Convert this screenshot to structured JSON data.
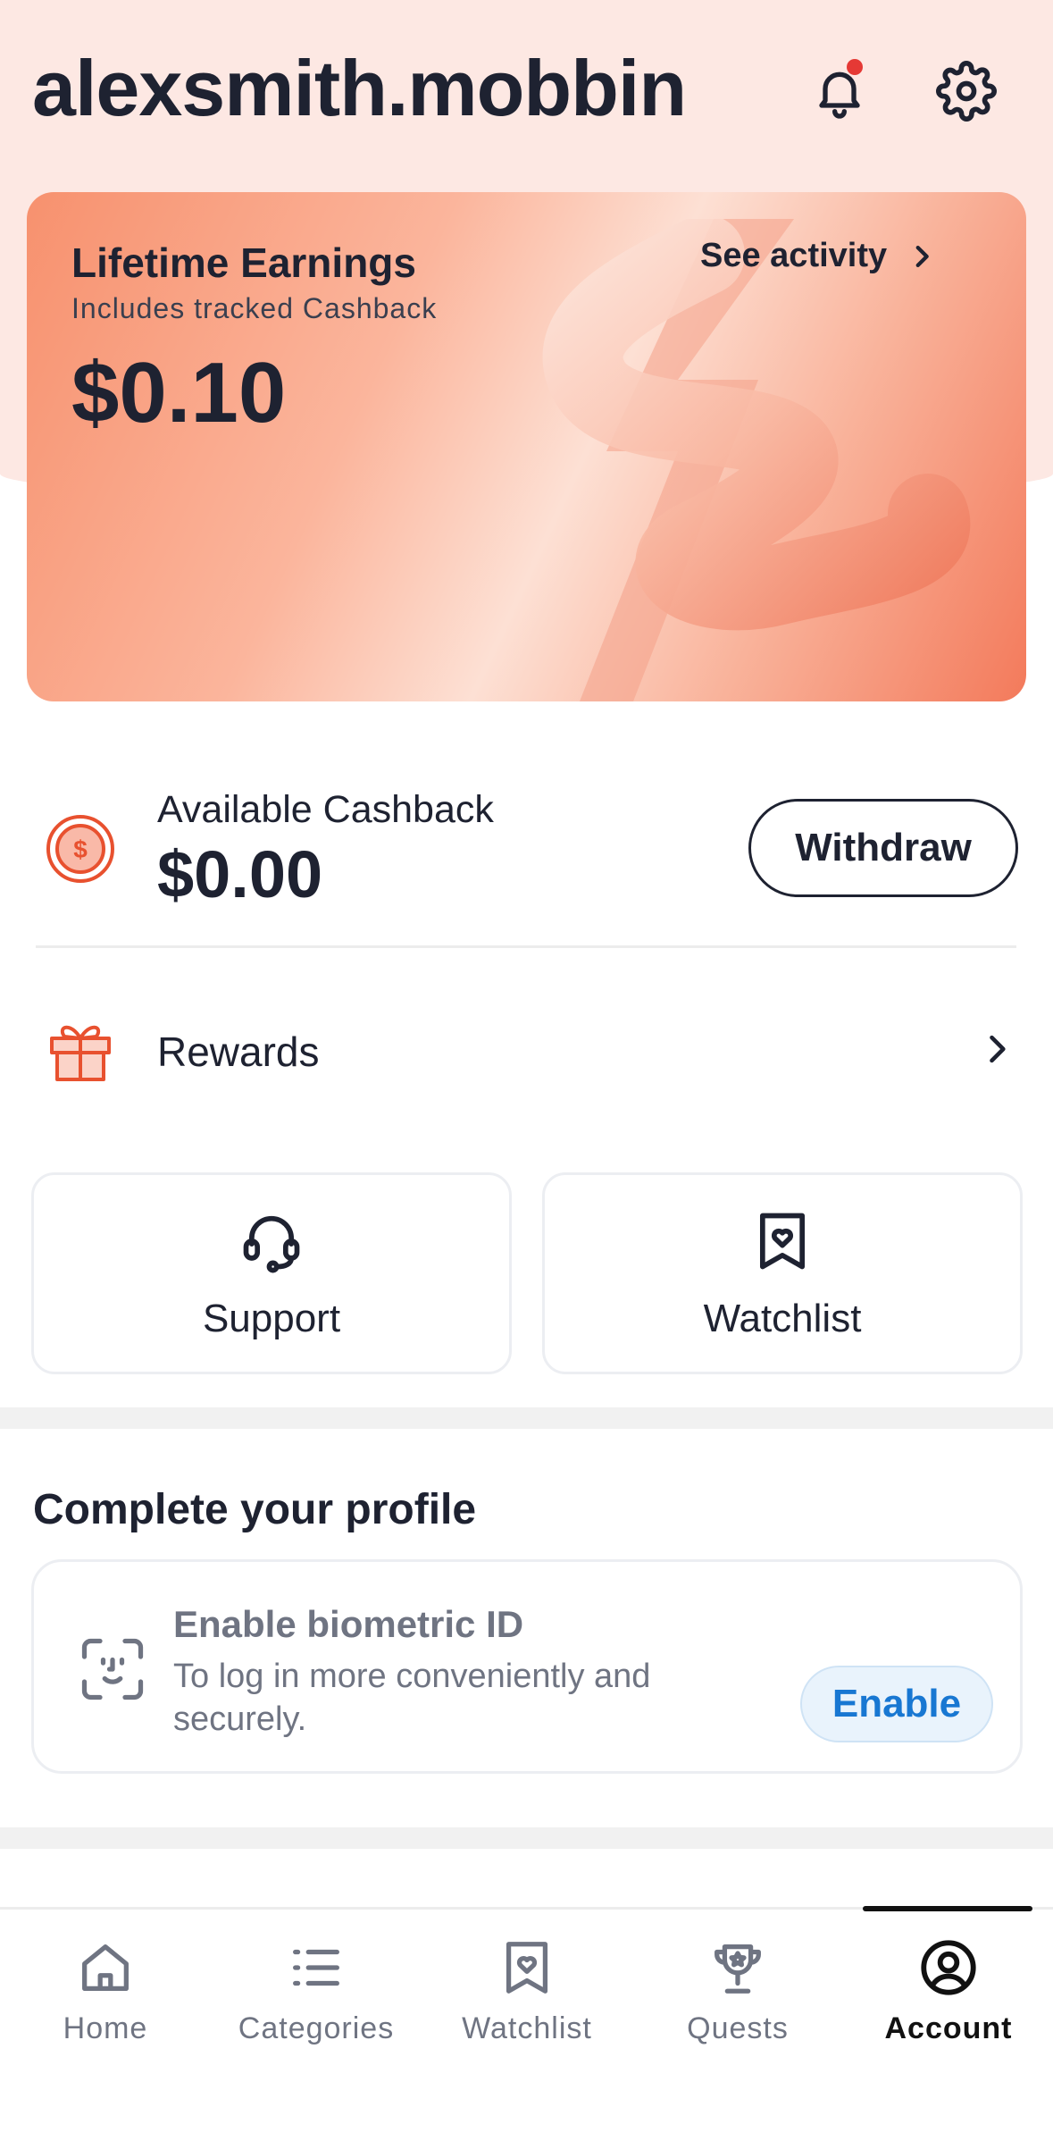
{
  "header": {
    "username": "alexsmith.mobbin",
    "has_notification": true
  },
  "earnings_card": {
    "title": "Lifetime Earnings",
    "subtitle": "Includes tracked Cashback",
    "amount": "$0.10",
    "link_label": "See activity"
  },
  "cashback": {
    "label": "Available Cashback",
    "amount": "$0.00",
    "button_label": "Withdraw"
  },
  "rewards": {
    "label": "Rewards"
  },
  "tiles": {
    "support_label": "Support",
    "watchlist_label": "Watchlist"
  },
  "profile": {
    "section_title": "Complete your profile",
    "card_title": "Enable biometric ID",
    "card_description": "To log in more conveniently and securely.",
    "button_label": "Enable"
  },
  "tabbar": {
    "tabs": [
      {
        "label": "Home",
        "icon": "home-icon",
        "active": false
      },
      {
        "label": "Categories",
        "icon": "list-icon",
        "active": false
      },
      {
        "label": "Watchlist",
        "icon": "bookmark-heart-icon",
        "active": false
      },
      {
        "label": "Quests",
        "icon": "trophy-icon",
        "active": false
      },
      {
        "label": "Account",
        "icon": "account-icon",
        "active": true
      }
    ]
  },
  "colors": {
    "accent": "#e8512f",
    "text_primary": "#1e2231",
    "text_muted": "#6f7482",
    "link_blue": "#1877d2",
    "header_bg": "#fde8e3"
  }
}
